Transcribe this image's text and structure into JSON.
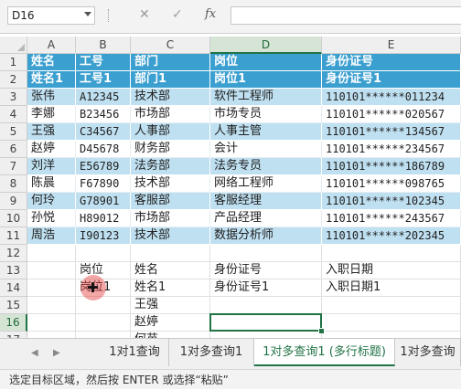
{
  "formula_bar": {
    "name_box": "D16",
    "cancel_icon": "close-icon",
    "enter_icon": "check-icon",
    "fx_label": "fx",
    "formula": ""
  },
  "columns": [
    "A",
    "B",
    "C",
    "D",
    "E"
  ],
  "rows": [
    "1",
    "2",
    "3",
    "4",
    "5",
    "6",
    "7",
    "8",
    "9",
    "10",
    "11",
    "12",
    "13",
    "14",
    "15",
    "16",
    "17"
  ],
  "header_row": {
    "row1": [
      "姓名",
      "工号",
      "部门",
      "岗位",
      "身份证号"
    ],
    "row2": [
      "姓名1",
      "工号1",
      "部门1",
      "岗位1",
      "身份证号1"
    ]
  },
  "table_rows": [
    [
      "张伟",
      "A12345",
      "技术部",
      "软件工程师",
      "110101******011234"
    ],
    [
      "李娜",
      "B23456",
      "市场部",
      "市场专员",
      "110101******020567"
    ],
    [
      "王强",
      "C34567",
      "人事部",
      "人事主管",
      "110101******134567"
    ],
    [
      "赵婷",
      "D45678",
      "财务部",
      "会计",
      "110101******234567"
    ],
    [
      "刘洋",
      "E56789",
      "法务部",
      "法务专员",
      "110101******186789"
    ],
    [
      "陈晨",
      "F67890",
      "技术部",
      "网络工程师",
      "110101******098765"
    ],
    [
      "何玲",
      "G78901",
      "客服部",
      "客服经理",
      "110101******102345"
    ],
    [
      "孙悦",
      "H89012",
      "市场部",
      "产品经理",
      "110101******243567"
    ],
    [
      "周浩",
      "I90123",
      "技术部",
      "数据分析师",
      "110101******202345"
    ]
  ],
  "lookup_area": {
    "row13": [
      "岗位",
      "姓名",
      "身份证号",
      "入职日期"
    ],
    "row14": [
      "岗位1",
      "姓名1",
      "身份证号1",
      "入职日期1"
    ],
    "names": [
      "王强",
      "赵婷",
      "何苗"
    ]
  },
  "sheet_tabs": [
    "1对1查询",
    "1对多查询1",
    "1对多查询1 (多行标题)",
    "1对多查询"
  ],
  "active_tab": 2,
  "status_bar": "选定目标区域，然后按 ENTER 或选择“粘贴”",
  "colors": {
    "header": "#3b9fd0",
    "band": "#bfe0f1",
    "accent": "#217346"
  }
}
